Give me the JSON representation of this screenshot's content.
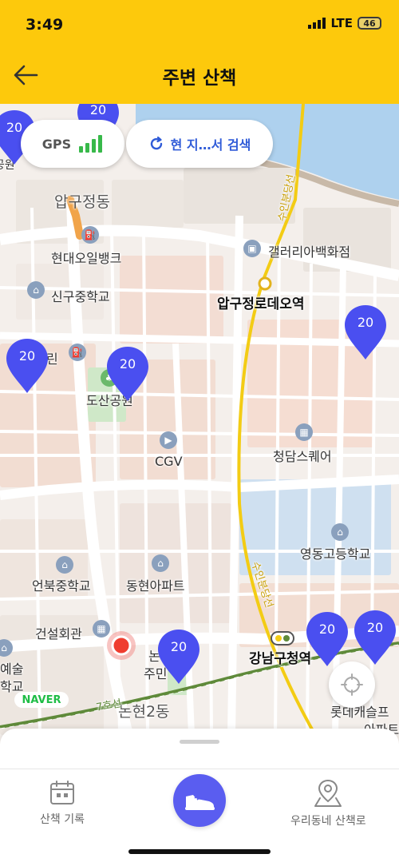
{
  "status": {
    "time": "3:49",
    "network": "LTE",
    "battery": "46"
  },
  "header": {
    "title": "주변 산책"
  },
  "gps": {
    "label": "GPS"
  },
  "search": {
    "label": "현 지…서 검색"
  },
  "map": {
    "places": {
      "apgujeong_dong": "압구정동",
      "hyundai_oilbank": "현대오일뱅크",
      "galleria": "갤러리아백화점",
      "singu_middle": "신구중학교",
      "apgujeong_rodeo": "압구정로데오역",
      "dosan_park": "도산공원",
      "rin": "린",
      "cgv": "CGV",
      "cheongdam_square": "청담스퀘어",
      "yeongdong_high": "영동고등학교",
      "eonbuk_middle": "언북중학교",
      "donghyun_apt": "동현아파트",
      "construction_hall": "건설회관",
      "gangnam_office": "강남구청역",
      "nonhyeon2": "논현2동",
      "nonhyeon_fragment": "논",
      "jumin_fragment": "주민",
      "art_fragment": "예술",
      "school_fragment": "학교",
      "lotte_castle": "롯데캐슬프",
      "apartment_fragment": "아파트",
      "line_suinbundang_top": "수인분당선",
      "line_suinbundang_mid": "수인분당선",
      "line_1": "7호선",
      "left_fragment": "동공원"
    },
    "pins": [
      "20",
      "20",
      "20",
      "20",
      "20",
      "20",
      "20",
      "20"
    ],
    "naver": "NAVER"
  },
  "tabs": {
    "left": "산책 기록",
    "right": "우리동네 산책로"
  },
  "colors": {
    "accent": "#fdc90c",
    "pin": "#4a4ff0",
    "primary": "#5a5df0"
  }
}
